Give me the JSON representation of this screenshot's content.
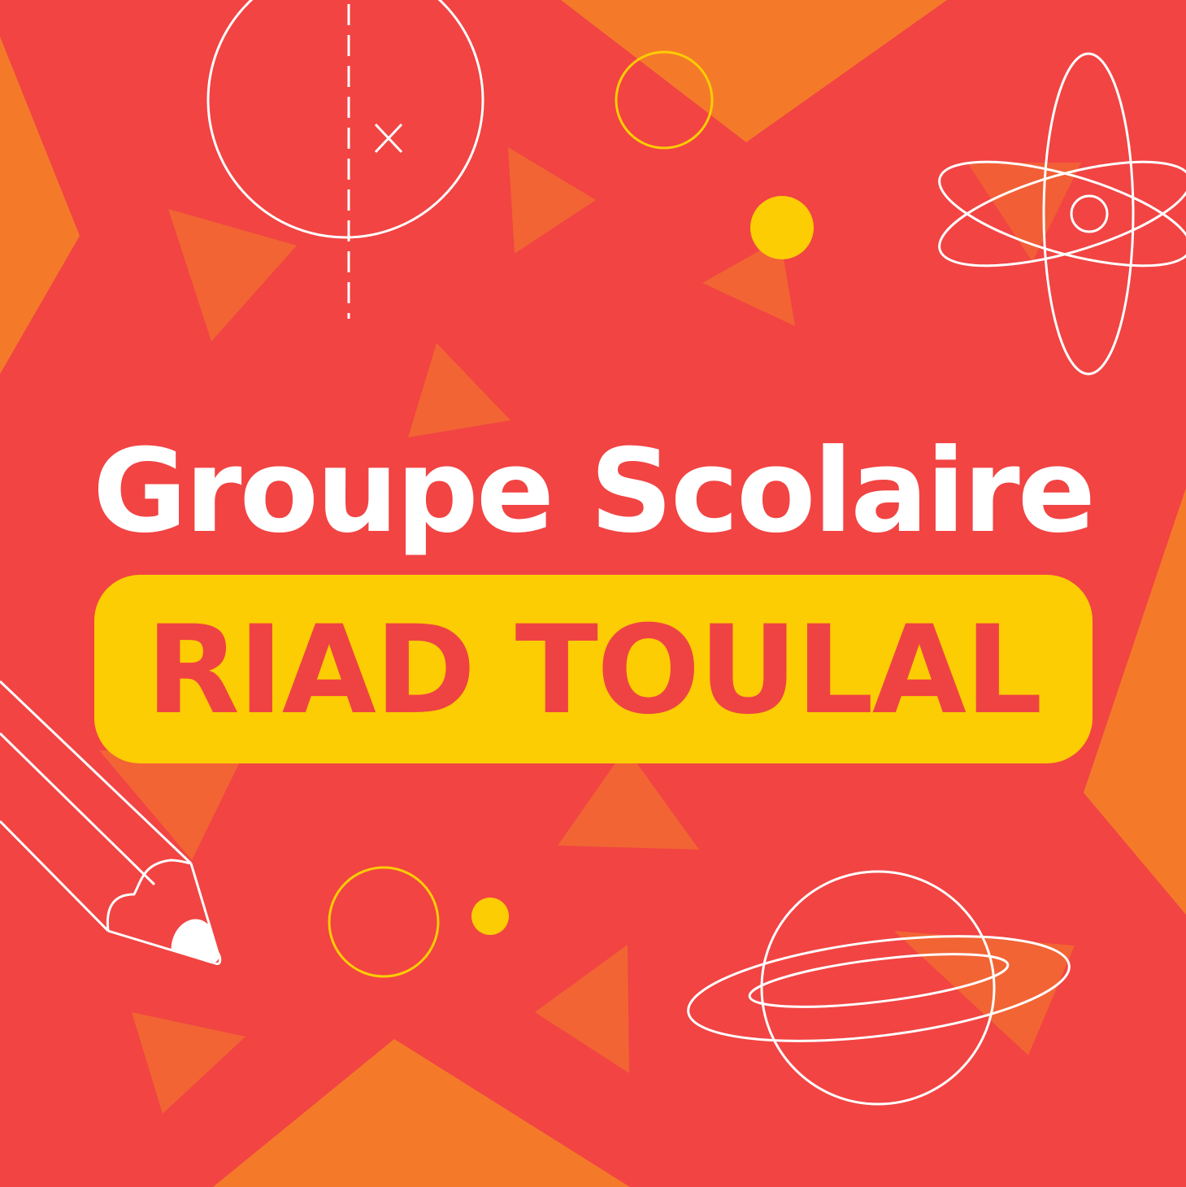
{
  "heading": "Groupe Scolaire",
  "name": "RIAD TOULAL",
  "colors": {
    "background": "#f14443",
    "orange_shapes": "#f47a2a",
    "yellow": "#fccd03",
    "outline": "#ffffff",
    "name_text": "#ef4343"
  },
  "decorations": [
    "circle-compass-icon",
    "atom-icon",
    "pencil-icon",
    "planet-icon",
    "yellow-dot-icon",
    "ring-outline-icon"
  ]
}
